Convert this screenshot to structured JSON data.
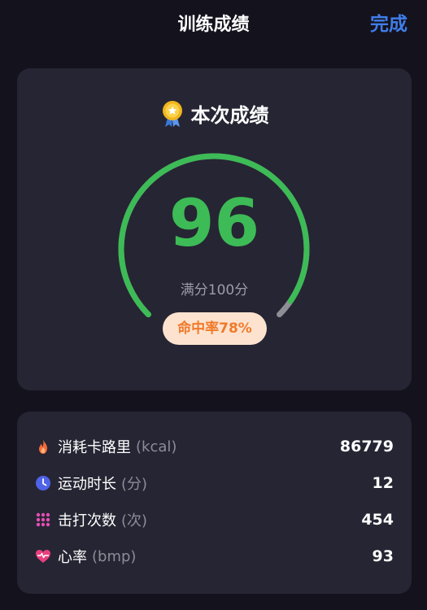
{
  "header": {
    "title": "训练成绩",
    "done_label": "完成"
  },
  "score_card": {
    "title": "本次成绩",
    "score": "96",
    "score_fraction": 0.96,
    "full_score": "满分100分",
    "hit_rate": "命中率78%"
  },
  "stats": [
    {
      "label": "消耗卡路里",
      "unit": "(kcal)",
      "value": "86779",
      "icon": "flame-icon"
    },
    {
      "label": "运动时长",
      "unit": "(分)",
      "value": "12",
      "icon": "clock-icon"
    },
    {
      "label": "击打次数",
      "unit": "(次)",
      "value": "454",
      "icon": "grid-dots-icon"
    },
    {
      "label": "心率",
      "unit": "(bmp)",
      "value": "93",
      "icon": "heart-rate-icon"
    }
  ],
  "colors": {
    "background": "#14121c",
    "card": "#262533",
    "accent_blue": "#3f7dea",
    "score_green": "#3dbb56",
    "gauge_remaining": "#8e8e96",
    "hit_rate_bg": "#fde3cf",
    "hit_rate_text": "#f07a2a"
  }
}
